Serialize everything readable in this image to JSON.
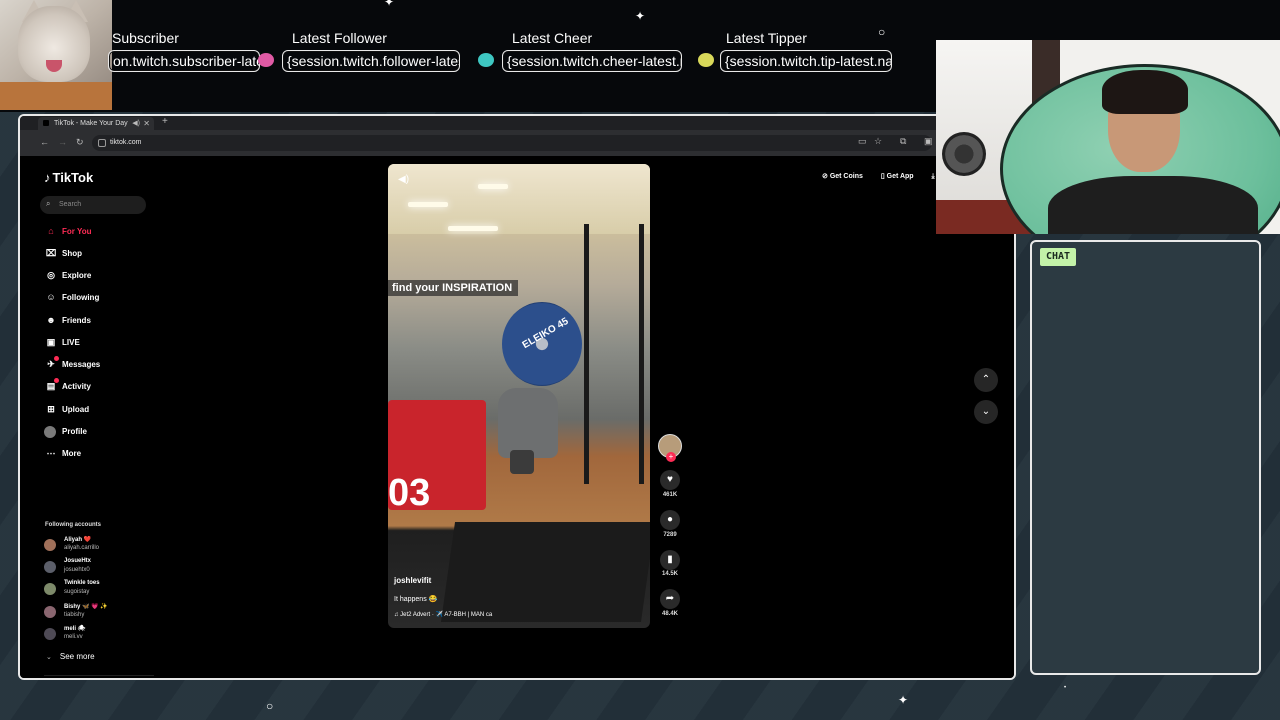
{
  "overlay": {
    "alerts": [
      {
        "label": "Subscriber",
        "value": "on.twitch.subscriber-latest.name}"
      },
      {
        "label": "Latest Follower",
        "value": "{session.twitch.follower-latest.name}"
      },
      {
        "label": "Latest Cheer",
        "value": "{session.twitch.cheer-latest.name}"
      },
      {
        "label": "Latest Tipper",
        "value": "{session.twitch.tip-latest.name}"
      }
    ],
    "gem_colors": [
      "#e05aa5",
      "#3ec7c2",
      "#d8d85a"
    ],
    "chat_label": "CHAT",
    "chat_tag_color": "#c3f2a8"
  },
  "browser": {
    "tab_title": "TikTok - Make Your Day",
    "new_tab_icon": "+",
    "url": "tiktok.com"
  },
  "tiktok": {
    "brand": "TikTok",
    "brand_color": "#fe2c55",
    "search_placeholder": "Search",
    "nav": [
      {
        "label": "For You",
        "icon": "home-icon",
        "glyph": "⌂",
        "active": true
      },
      {
        "label": "Shop",
        "icon": "shop-icon",
        "glyph": "⌧",
        "active": false
      },
      {
        "label": "Explore",
        "icon": "compass-icon",
        "glyph": "◎",
        "active": false
      },
      {
        "label": "Following",
        "icon": "following-icon",
        "glyph": "☺",
        "active": false
      },
      {
        "label": "Friends",
        "icon": "friends-icon",
        "glyph": "☻",
        "active": false
      },
      {
        "label": "LIVE",
        "icon": "live-icon",
        "glyph": "▣",
        "active": false
      },
      {
        "label": "Messages",
        "icon": "messages-icon",
        "glyph": "✈",
        "active": false
      },
      {
        "label": "Activity",
        "icon": "activity-icon",
        "glyph": "▤",
        "active": false
      },
      {
        "label": "Upload",
        "icon": "upload-icon",
        "glyph": "⊞",
        "active": false
      },
      {
        "label": "Profile",
        "icon": "profile-icon",
        "glyph": "",
        "active": false
      },
      {
        "label": "More",
        "icon": "more-icon",
        "glyph": "⋯",
        "active": false
      }
    ],
    "following_title": "Following accounts",
    "following_accounts": [
      {
        "name": "Aliyah ❤️",
        "handle": "aliyah.carrillo"
      },
      {
        "name": "JosueHtx",
        "handle": "josuehtx0"
      },
      {
        "name": "Twinkle toes",
        "handle": "sugoistay"
      },
      {
        "name": "Bishy 🦋 💗 ✨",
        "handle": "tiabishy"
      },
      {
        "name": "meli 🕷",
        "handle": "meli.vv"
      }
    ],
    "see_more": "See more",
    "top_links": [
      "Get Coins",
      "Get App",
      "PC"
    ],
    "video": {
      "author": "joshlevifit",
      "caption": "It happens 😂",
      "sound": "♫ Jet2 Advert · ✈️ A7-BBH | MAN ca",
      "banner_text": "find your INSPIRATION",
      "box_number": "03",
      "plate_text": "ELEIKO 45"
    },
    "actions": {
      "likes": "461K",
      "comments": "7289",
      "saves": "14.5K",
      "shares": "48.4K"
    }
  }
}
